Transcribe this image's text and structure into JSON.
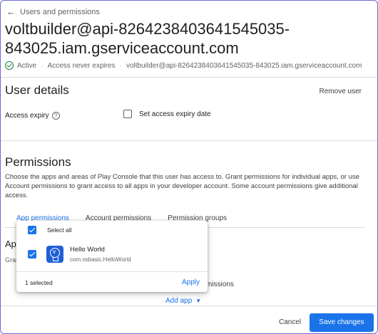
{
  "header": {
    "back_label": "Users and permissions",
    "title": "voltbuilder@api-8264238403641545035-843025.iam.gserviceaccount.com",
    "status": {
      "active": "Active",
      "expiry": "Access never expires",
      "email": "voltbuilder@api-8264238403641545035-843025.iam.gserviceaccount.com"
    }
  },
  "user_details": {
    "heading": "User details",
    "remove_user": "Remove user",
    "access_expiry_label": "Access expiry",
    "help_icon_glyph": "?",
    "set_expiry_label": "Set access expiry date"
  },
  "permissions": {
    "heading": "Permissions",
    "description": "Choose the apps and areas of Play Console that this user has access to. Grant permissions for individual apps, or use Account permissions to grant access to all apps in your developer account. Some account permissions give additional access.",
    "tabs": [
      {
        "label": "App permissions"
      },
      {
        "label": "Account permissions"
      },
      {
        "label": "Permission groups"
      }
    ],
    "app_section_heading_fragment": "App",
    "app_section_sub_fragment": "Gran",
    "background_permissions_fragment": "missions",
    "add_app": "Add app"
  },
  "popup": {
    "select_all": "Select all",
    "apps": [
      {
        "name": "Hello World",
        "package": "com.nsbasic.HelloWorld",
        "checked": true
      }
    ],
    "selected_count": "1 selected",
    "apply": "Apply"
  },
  "footer": {
    "cancel": "Cancel",
    "save": "Save changes"
  },
  "colors": {
    "accent": "#1a73e8",
    "active_green": "#188038",
    "app_icon_bg": "#1f5fd6"
  },
  "icons": {
    "back": "arrow-left-icon",
    "status": "check-circle-icon",
    "help": "help-circle-icon",
    "caret": "caret-down-icon",
    "app": "lightbulb-app-icon"
  }
}
